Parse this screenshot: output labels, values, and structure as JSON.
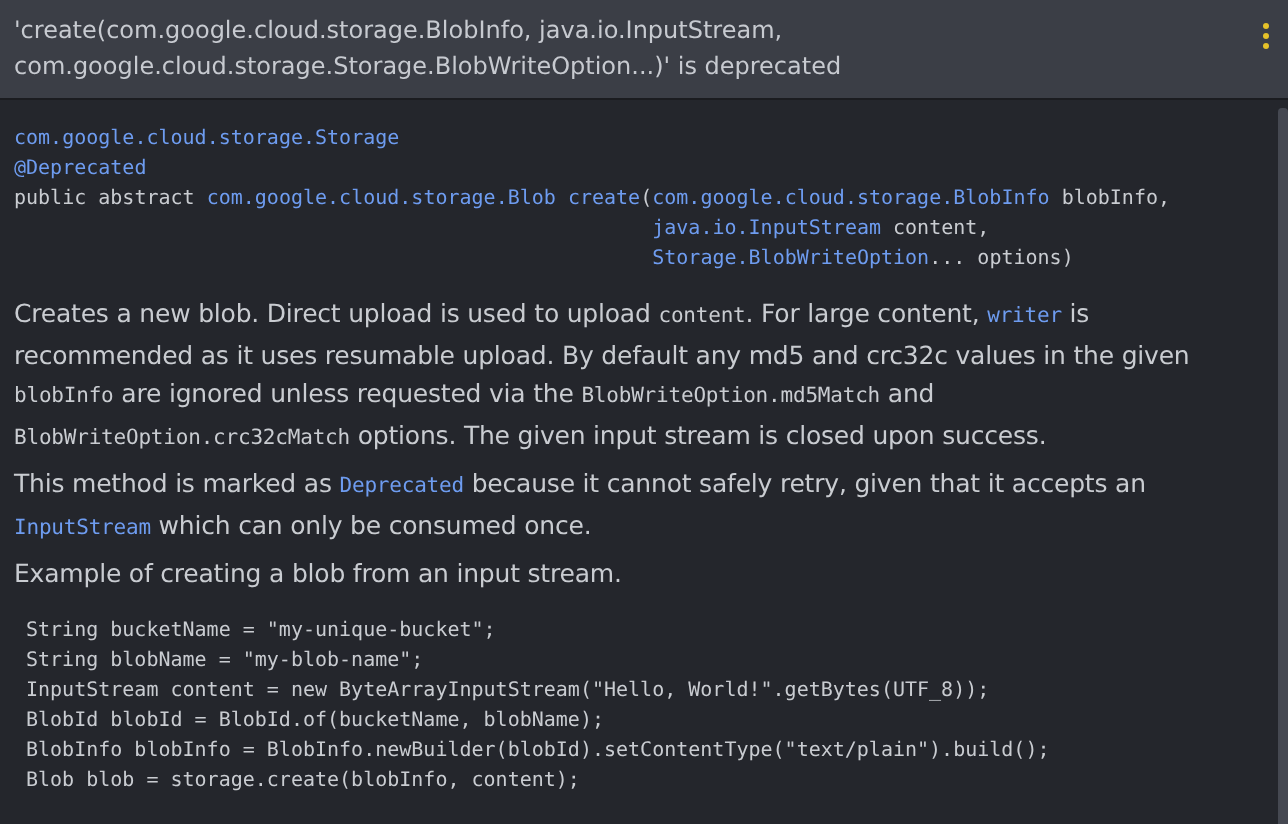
{
  "header": {
    "message": "'create(com.google.cloud.storage.BlobInfo, java.io.InputStream, com.google.cloud.storage.Storage.BlobWriteOption...)' is deprecated"
  },
  "signature": {
    "container": "com.google.cloud.storage.Storage",
    "annotation": "@Deprecated",
    "head": [
      {
        "kind": "plain",
        "text": "public abstract "
      },
      {
        "kind": "link",
        "text": "com.google.cloud.storage.Blob "
      },
      {
        "kind": "link",
        "text": "create"
      },
      {
        "kind": "plain",
        "text": "("
      }
    ],
    "params": [
      [
        {
          "kind": "link",
          "text": "com.google.cloud.storage.BlobInfo"
        },
        {
          "kind": "plain",
          "text": " blobInfo,"
        }
      ],
      [
        {
          "kind": "link",
          "text": "java.io.InputStream"
        },
        {
          "kind": "plain",
          "text": " content,"
        }
      ],
      [
        {
          "kind": "link",
          "text": "Storage.BlobWriteOption"
        },
        {
          "kind": "plain",
          "text": "... options)"
        }
      ]
    ]
  },
  "description": [
    [
      {
        "kind": "text",
        "text": "Creates a new blob. Direct upload is used to upload "
      },
      {
        "kind": "code",
        "text": "content"
      },
      {
        "kind": "text",
        "text": ". For large content, "
      },
      {
        "kind": "link",
        "text": "writer"
      },
      {
        "kind": "text",
        "text": " is recommended as it uses resumable upload. By default any md5 and crc32c values in the given "
      },
      {
        "kind": "code",
        "text": "blobInfo"
      },
      {
        "kind": "text",
        "text": " are ignored unless requested via the "
      },
      {
        "kind": "code",
        "text": "BlobWriteOption.md5Match"
      },
      {
        "kind": "text",
        "text": " and "
      },
      {
        "kind": "code",
        "text": "BlobWriteOption.crc32cMatch"
      },
      {
        "kind": "text",
        "text": " options. The given input stream is closed upon success."
      }
    ],
    [
      {
        "kind": "text",
        "text": "This method is marked as "
      },
      {
        "kind": "link",
        "text": "Deprecated"
      },
      {
        "kind": "text",
        "text": " because it cannot safely retry, given that it accepts an "
      },
      {
        "kind": "link",
        "text": "InputStream"
      },
      {
        "kind": "text",
        "text": " which can only be consumed once."
      }
    ],
    [
      {
        "kind": "text",
        "text": "Example of creating a blob from an input stream."
      }
    ]
  ],
  "example": [
    "String bucketName = \"my-unique-bucket\";",
    "String blobName = \"my-blob-name\";",
    "InputStream content = new ByteArrayInputStream(\"Hello, World!\".getBytes(UTF_8));",
    "BlobId blobId = BlobId.of(bucketName, blobName);",
    "BlobInfo blobInfo = BlobInfo.newBuilder(blobId).setContentType(\"text/plain\").build();",
    "Blob blob = storage.create(blobInfo, content);"
  ]
}
